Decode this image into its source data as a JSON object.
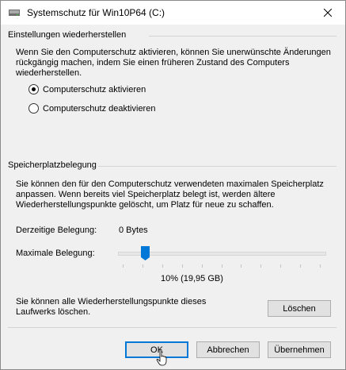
{
  "window": {
    "title": "Systemschutz für Win10P64 (C:)",
    "close_icon": "close-icon",
    "title_icon": "drive-icon"
  },
  "restore_settings": {
    "heading": "Einstellungen wiederherstellen",
    "description_lines": [
      "Wenn Sie den Computerschutz aktivieren, können Sie unerwünschte Änderungen",
      "rückgängig machen, indem Sie einen früheren Zustand des Computers",
      "wiederherstellen."
    ],
    "options": [
      {
        "label": "Computerschutz aktivieren",
        "selected": true
      },
      {
        "label": "Computerschutz deaktivieren",
        "selected": false
      }
    ]
  },
  "disk_usage": {
    "heading": "Speicherplatzbelegung",
    "description_lines": [
      "Sie können den für den Computerschutz verwendeten maximalen Speicherplatz",
      "anpassen. Wenn bereits viel Speicherplatz belegt ist, werden ältere",
      "Wiederherstellungspunkte gelöscht, um Platz für neue zu schaffen."
    ],
    "current_label": "Derzeitige Belegung:",
    "current_value": "0 Bytes",
    "max_label": "Maximale Belegung:",
    "max_value_text": "10% (19,95 GB)",
    "max_fraction": 0.1,
    "delete_text_lines": [
      "Sie können alle Wiederherstellungspunkte dieses",
      "Laufwerks löschen."
    ],
    "delete_button": "Löschen"
  },
  "footer": {
    "ok": "OK",
    "cancel": "Abbrechen",
    "apply": "Übernehmen"
  },
  "colors": {
    "accent": "#0078d7",
    "background": "#f0f0f0"
  }
}
